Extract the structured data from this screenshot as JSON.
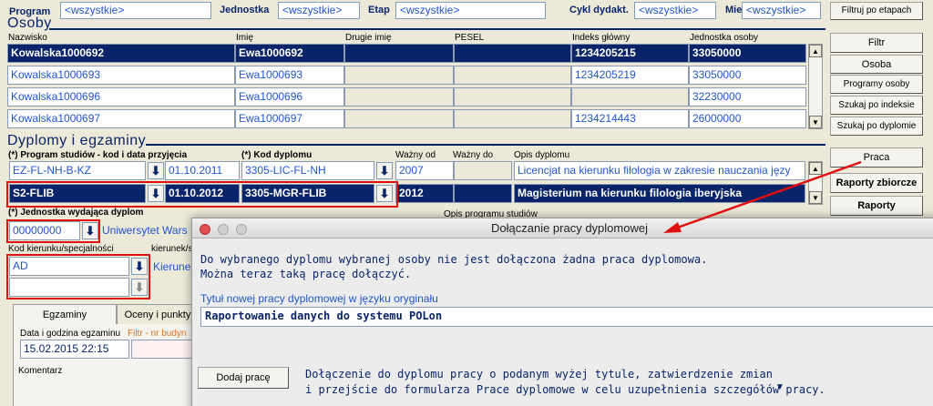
{
  "filters": {
    "program_label": "Program",
    "program_value": "<wszystkie>",
    "jednostka_label": "Jednostka",
    "jednostka_value": "<wszystkie>",
    "etap_label": "Etap",
    "etap_value": "<wszystkie>",
    "cykl_label": "Cykl dydakt.",
    "cykl_value": "<wszystkie>",
    "miejsce_label": "Miejsce",
    "miejsce_value": "<wszystkie>",
    "filter_button": "Filtruj po etapach"
  },
  "osoby": {
    "title": "Osoby",
    "columns": [
      "Nazwisko",
      "Imię",
      "Drugie imię",
      "PESEL",
      "Indeks główny",
      "Jednostka osoby"
    ],
    "rows": [
      [
        "Kowalska1000692",
        "Ewa1000692",
        "",
        "",
        "1234205215",
        "33050000"
      ],
      [
        "Kowalska1000693",
        "Ewa1000693",
        "",
        "",
        "1234205219",
        "33050000"
      ],
      [
        "Kowalska1000696",
        "Ewa1000696",
        "",
        "",
        "",
        "32230000"
      ],
      [
        "Kowalska1000697",
        "Ewa1000697",
        "",
        "",
        "1234214443",
        "26000000"
      ]
    ],
    "selected_row": 0
  },
  "side_buttons": [
    "Filtr",
    "Osoba",
    "Programy osoby",
    "Szukaj po indeksie",
    "Szukaj po dyplomie"
  ],
  "side_buttons2": [
    "Praca",
    "Raporty zbiorcze",
    "Raporty"
  ],
  "dyplomy": {
    "title": "Dyplomy i egzaminy",
    "col_program": "(*) Program studiów - kod i data przyjęcia",
    "col_kod": "(*) Kod dyplomu",
    "col_wazny_od": "Ważny od",
    "col_wazny_do": "Ważny do",
    "col_opis": "Opis dyplomu",
    "rows": [
      {
        "program": "EZ-FL-NH-B-KZ",
        "data": "01.10.2011",
        "kod": "3305-LIC-FL-NH",
        "od": "2007",
        "do": "",
        "opis": "Licencjat na kierunku filologia w zakresie nauczania języ"
      },
      {
        "program": "S2-FLIB",
        "data": "01.10.2012",
        "kod": "3305-MGR-FLIB",
        "od": "2012",
        "do": "",
        "opis": "Magisterium na kierunku filologia iberyjska"
      }
    ],
    "jednostka_label": "(*) Jednostka wydająca dyplom",
    "jednostka_value": "00000000",
    "jednostka_name": "Uniwersytet Wars",
    "opis_programu_label": "Opis programu studiów",
    "kod_kierunku_label": "Kod kierunku/specjalności",
    "kierunek_label": "kierunek/s",
    "kod_kierunku_value": "AD",
    "kierunek_value": "Kierune"
  },
  "tabs": {
    "egzaminy": "Egzaminy",
    "oceny": "Oceny i punkty"
  },
  "egzamin": {
    "data_label": "Data i godzina egzaminu",
    "filtr_label": "Filtr - nr budyn",
    "data_value": "15.02.2015 22:15",
    "komentarz_label": "Komentarz"
  },
  "dialog": {
    "title": "Dołączanie pracy dyplomowej",
    "message1": "Do wybranego dyplomu wybranej osoby nie jest dołączona żadna praca dyplomowa.",
    "message2": "Można teraz taką pracę dołączyć.",
    "tytul_label": "Tytuł nowej pracy dyplomowej w języku oryginału",
    "tytul_value": "Raportowanie danych do systemu POLon",
    "add_button": "Dodaj pracę",
    "add_desc1": "Dołączenie do dyplomu pracy o podanym wyżej tytule, zatwierdzenie zmian",
    "add_desc2": "i przejście do formularza Prace dyplomowe w celu uzupełnienia szczegółów pracy."
  },
  "colors": {
    "accent": "#0a246a",
    "link": "#2255cc",
    "annotation": "#e01010"
  }
}
